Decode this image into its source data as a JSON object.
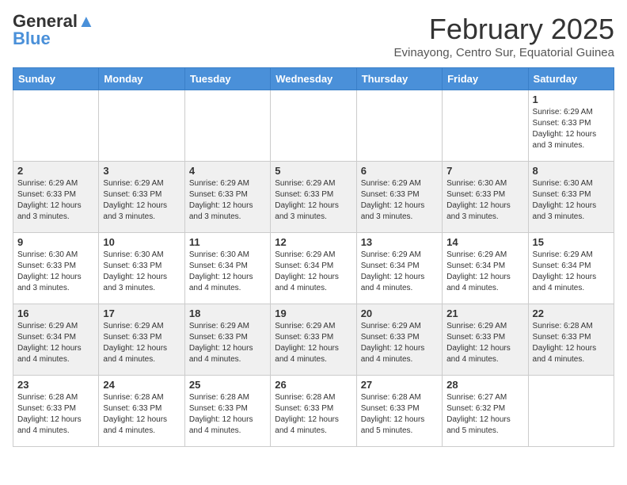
{
  "logo": {
    "general": "General",
    "blue": "Blue"
  },
  "header": {
    "month": "February 2025",
    "location": "Evinayong, Centro Sur, Equatorial Guinea"
  },
  "weekdays": [
    "Sunday",
    "Monday",
    "Tuesday",
    "Wednesday",
    "Thursday",
    "Friday",
    "Saturday"
  ],
  "weeks": [
    [
      {
        "day": "",
        "info": ""
      },
      {
        "day": "",
        "info": ""
      },
      {
        "day": "",
        "info": ""
      },
      {
        "day": "",
        "info": ""
      },
      {
        "day": "",
        "info": ""
      },
      {
        "day": "",
        "info": ""
      },
      {
        "day": "1",
        "info": "Sunrise: 6:29 AM\nSunset: 6:33 PM\nDaylight: 12 hours\nand 3 minutes."
      }
    ],
    [
      {
        "day": "2",
        "info": "Sunrise: 6:29 AM\nSunset: 6:33 PM\nDaylight: 12 hours\nand 3 minutes."
      },
      {
        "day": "3",
        "info": "Sunrise: 6:29 AM\nSunset: 6:33 PM\nDaylight: 12 hours\nand 3 minutes."
      },
      {
        "day": "4",
        "info": "Sunrise: 6:29 AM\nSunset: 6:33 PM\nDaylight: 12 hours\nand 3 minutes."
      },
      {
        "day": "5",
        "info": "Sunrise: 6:29 AM\nSunset: 6:33 PM\nDaylight: 12 hours\nand 3 minutes."
      },
      {
        "day": "6",
        "info": "Sunrise: 6:29 AM\nSunset: 6:33 PM\nDaylight: 12 hours\nand 3 minutes."
      },
      {
        "day": "7",
        "info": "Sunrise: 6:30 AM\nSunset: 6:33 PM\nDaylight: 12 hours\nand 3 minutes."
      },
      {
        "day": "8",
        "info": "Sunrise: 6:30 AM\nSunset: 6:33 PM\nDaylight: 12 hours\nand 3 minutes."
      }
    ],
    [
      {
        "day": "9",
        "info": "Sunrise: 6:30 AM\nSunset: 6:33 PM\nDaylight: 12 hours\nand 3 minutes."
      },
      {
        "day": "10",
        "info": "Sunrise: 6:30 AM\nSunset: 6:33 PM\nDaylight: 12 hours\nand 3 minutes."
      },
      {
        "day": "11",
        "info": "Sunrise: 6:30 AM\nSunset: 6:34 PM\nDaylight: 12 hours\nand 4 minutes."
      },
      {
        "day": "12",
        "info": "Sunrise: 6:29 AM\nSunset: 6:34 PM\nDaylight: 12 hours\nand 4 minutes."
      },
      {
        "day": "13",
        "info": "Sunrise: 6:29 AM\nSunset: 6:34 PM\nDaylight: 12 hours\nand 4 minutes."
      },
      {
        "day": "14",
        "info": "Sunrise: 6:29 AM\nSunset: 6:34 PM\nDaylight: 12 hours\nand 4 minutes."
      },
      {
        "day": "15",
        "info": "Sunrise: 6:29 AM\nSunset: 6:34 PM\nDaylight: 12 hours\nand 4 minutes."
      }
    ],
    [
      {
        "day": "16",
        "info": "Sunrise: 6:29 AM\nSunset: 6:34 PM\nDaylight: 12 hours\nand 4 minutes."
      },
      {
        "day": "17",
        "info": "Sunrise: 6:29 AM\nSunset: 6:33 PM\nDaylight: 12 hours\nand 4 minutes."
      },
      {
        "day": "18",
        "info": "Sunrise: 6:29 AM\nSunset: 6:33 PM\nDaylight: 12 hours\nand 4 minutes."
      },
      {
        "day": "19",
        "info": "Sunrise: 6:29 AM\nSunset: 6:33 PM\nDaylight: 12 hours\nand 4 minutes."
      },
      {
        "day": "20",
        "info": "Sunrise: 6:29 AM\nSunset: 6:33 PM\nDaylight: 12 hours\nand 4 minutes."
      },
      {
        "day": "21",
        "info": "Sunrise: 6:29 AM\nSunset: 6:33 PM\nDaylight: 12 hours\nand 4 minutes."
      },
      {
        "day": "22",
        "info": "Sunrise: 6:28 AM\nSunset: 6:33 PM\nDaylight: 12 hours\nand 4 minutes."
      }
    ],
    [
      {
        "day": "23",
        "info": "Sunrise: 6:28 AM\nSunset: 6:33 PM\nDaylight: 12 hours\nand 4 minutes."
      },
      {
        "day": "24",
        "info": "Sunrise: 6:28 AM\nSunset: 6:33 PM\nDaylight: 12 hours\nand 4 minutes."
      },
      {
        "day": "25",
        "info": "Sunrise: 6:28 AM\nSunset: 6:33 PM\nDaylight: 12 hours\nand 4 minutes."
      },
      {
        "day": "26",
        "info": "Sunrise: 6:28 AM\nSunset: 6:33 PM\nDaylight: 12 hours\nand 4 minutes."
      },
      {
        "day": "27",
        "info": "Sunrise: 6:28 AM\nSunset: 6:33 PM\nDaylight: 12 hours\nand 5 minutes."
      },
      {
        "day": "28",
        "info": "Sunrise: 6:27 AM\nSunset: 6:32 PM\nDaylight: 12 hours\nand 5 minutes."
      },
      {
        "day": "",
        "info": ""
      }
    ]
  ]
}
